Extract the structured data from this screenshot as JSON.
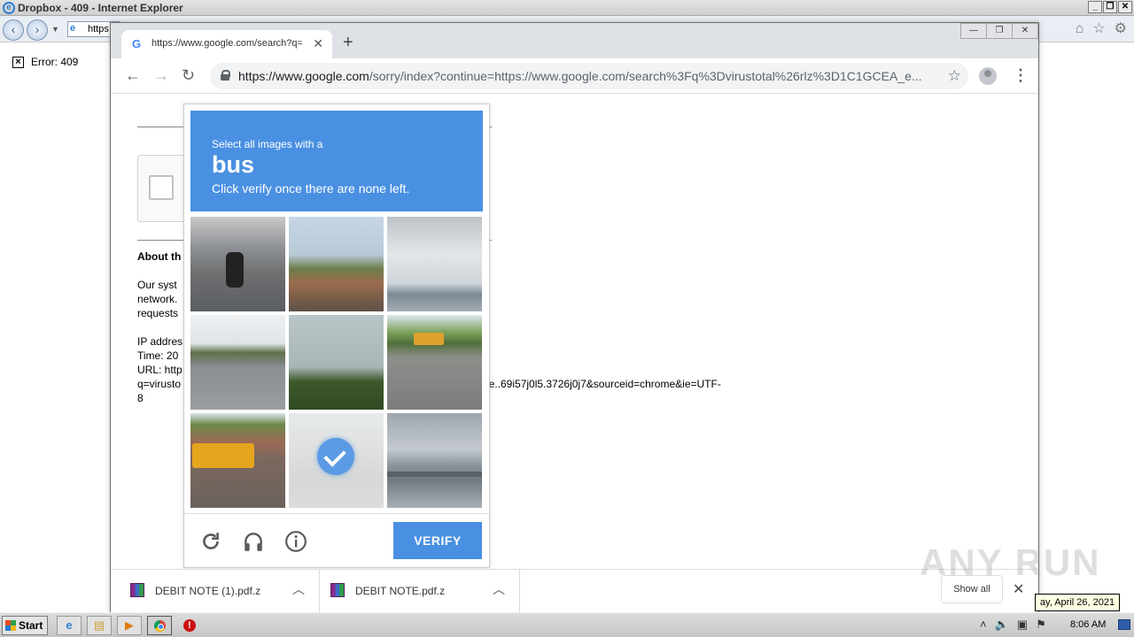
{
  "ie": {
    "title": "Dropbox - 409 - Internet Explorer",
    "address_text": "https",
    "error_text": "Error: 409"
  },
  "chrome": {
    "tab_title": "https://www.google.com/search?q=",
    "url_host": "https://www.google.com",
    "url_path": "/sorry/index?continue=https://www.google.com/search%3Fq%3Dvirustotal%26rlz%3D1C1GCEA_e..."
  },
  "page": {
    "about": "About th",
    "sys_lines": [
      "Our syst",
      "network.",
      "requests"
    ],
    "ip": "IP addres",
    "time": "Time: 20",
    "url": "URL: http",
    "q": "q=virusto",
    "url_tail": "ome..69i57j0l5.3726j0j7&sourceid=chrome&ie=UTF-",
    "last": "8"
  },
  "captcha": {
    "instruction": "Select all images with a",
    "target": "bus",
    "subtext": "Click verify once there are none left.",
    "selected_tile": 8,
    "verify_label": "VERIFY",
    "icons": [
      "reload-icon",
      "audio-icon",
      "info-icon"
    ],
    "accent_color": "#4a90e2"
  },
  "downloads": {
    "items": [
      {
        "name": "DEBIT NOTE (1).pdf.z"
      },
      {
        "name": "DEBIT NOTE.pdf.z"
      }
    ],
    "show_all": "Show all"
  },
  "watermark": "ANY RUN",
  "date_tooltip": "ay, April 26, 2021",
  "taskbar": {
    "start_label": "Start",
    "clock": "8:06 AM"
  }
}
